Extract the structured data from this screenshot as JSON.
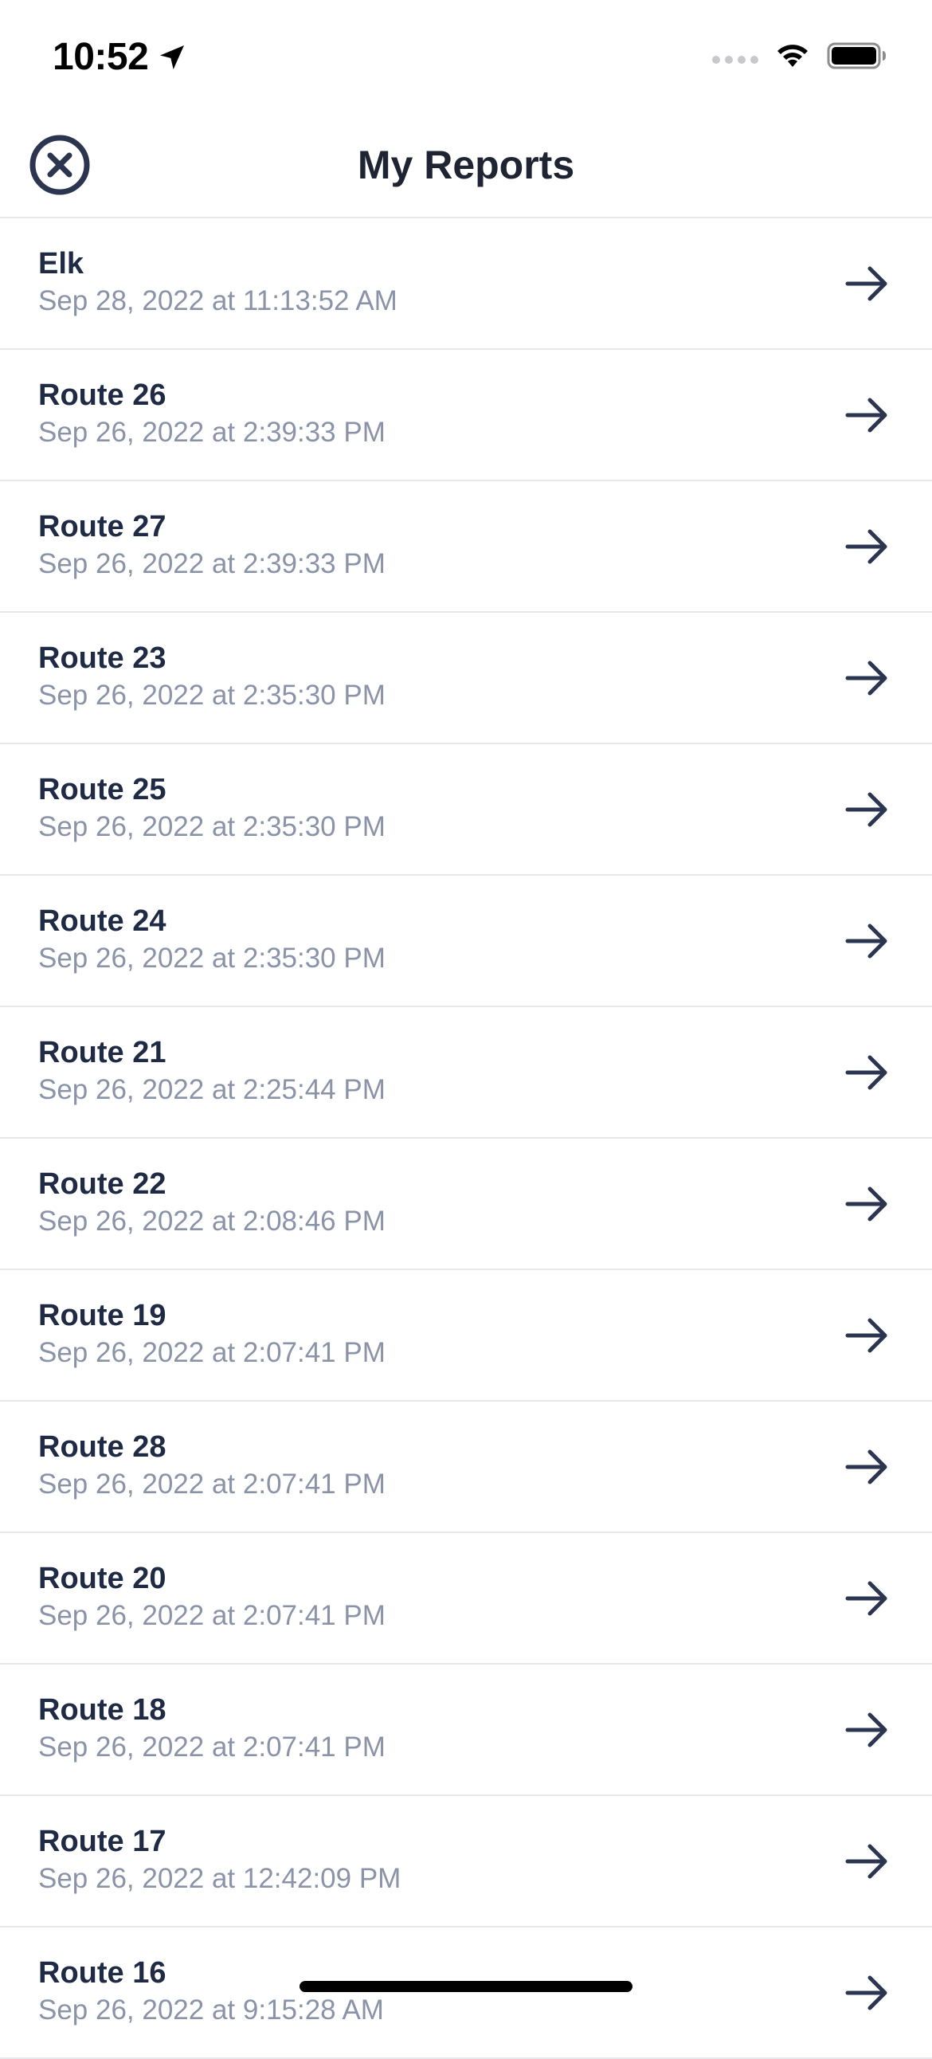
{
  "status_bar": {
    "time": "10:52",
    "icons": [
      "location-arrow-icon",
      "cellular-signal-icon",
      "wifi-icon",
      "battery-icon"
    ]
  },
  "header": {
    "title": "My Reports",
    "close_icon": "close-circle-icon"
  },
  "reports": [
    {
      "name": "Elk",
      "date": "Sep 28, 2022 at 11:13:52 AM"
    },
    {
      "name": "Route 26",
      "date": "Sep 26, 2022 at 2:39:33 PM"
    },
    {
      "name": "Route 27",
      "date": "Sep 26, 2022 at 2:39:33 PM"
    },
    {
      "name": "Route 23",
      "date": "Sep 26, 2022 at 2:35:30 PM"
    },
    {
      "name": "Route 25",
      "date": "Sep 26, 2022 at 2:35:30 PM"
    },
    {
      "name": "Route 24",
      "date": "Sep 26, 2022 at 2:35:30 PM"
    },
    {
      "name": "Route 21",
      "date": "Sep 26, 2022 at 2:25:44 PM"
    },
    {
      "name": "Route 22",
      "date": "Sep 26, 2022 at 2:08:46 PM"
    },
    {
      "name": "Route 19",
      "date": "Sep 26, 2022 at 2:07:41 PM"
    },
    {
      "name": "Route 28",
      "date": "Sep 26, 2022 at 2:07:41 PM"
    },
    {
      "name": "Route 20",
      "date": "Sep 26, 2022 at 2:07:41 PM"
    },
    {
      "name": "Route 18",
      "date": "Sep 26, 2022 at 2:07:41 PM"
    },
    {
      "name": "Route 17",
      "date": "Sep 26, 2022 at 12:42:09 PM"
    },
    {
      "name": "Route 16",
      "date": "Sep 26, 2022 at 9:15:28 AM"
    }
  ],
  "colors": {
    "primary_text": "#1f2a44",
    "secondary_text": "#8a93a8",
    "divider": "#e6e8ee",
    "background": "#ffffff"
  }
}
